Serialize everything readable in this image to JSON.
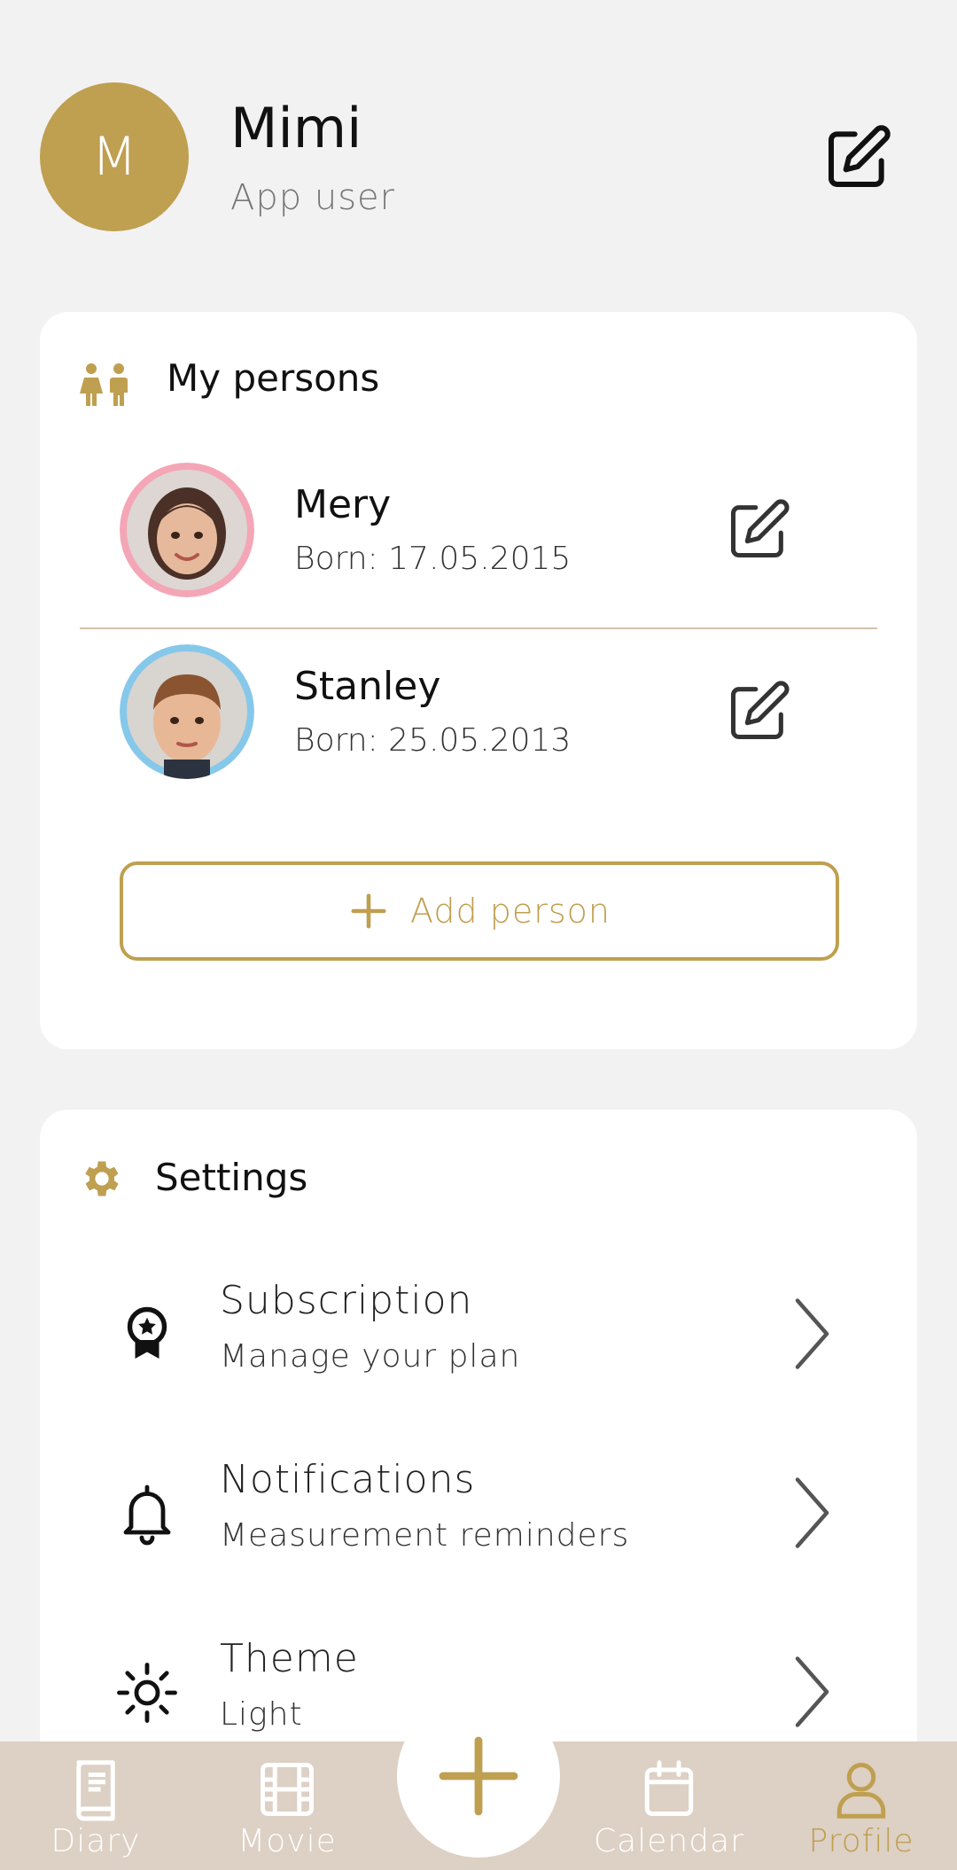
{
  "profile": {
    "initial": "M",
    "name": "Mimi",
    "role": "App user"
  },
  "persons": {
    "title": "My persons",
    "list": [
      {
        "name": "Mery",
        "born": "Born: 17.05.2015",
        "ring_color": "#f4a6b7"
      },
      {
        "name": "Stanley",
        "born": "Born: 25.05.2013",
        "ring_color": "#86c8ea"
      }
    ],
    "add_label": "Add person"
  },
  "settings": {
    "title": "Settings",
    "items": [
      {
        "title": "Subscription",
        "subtitle": "Manage your plan",
        "icon": "award-ribbon-icon"
      },
      {
        "title": "Notifications",
        "subtitle": "Measurement reminders",
        "icon": "bell-icon"
      },
      {
        "title": "Theme",
        "subtitle": "Light",
        "icon": "sun-icon"
      }
    ]
  },
  "nav": {
    "items": [
      {
        "label": "Diary",
        "icon": "book-icon",
        "active": false
      },
      {
        "label": "Movie",
        "icon": "film-icon",
        "active": false
      },
      {
        "label": "Calendar",
        "icon": "calendar-icon",
        "active": false
      },
      {
        "label": "Profile",
        "icon": "person-icon",
        "active": true
      }
    ]
  },
  "colors": {
    "accent": "#bf9f50",
    "nav_bg": "#ddd0c4",
    "background": "#f2f2f2"
  }
}
